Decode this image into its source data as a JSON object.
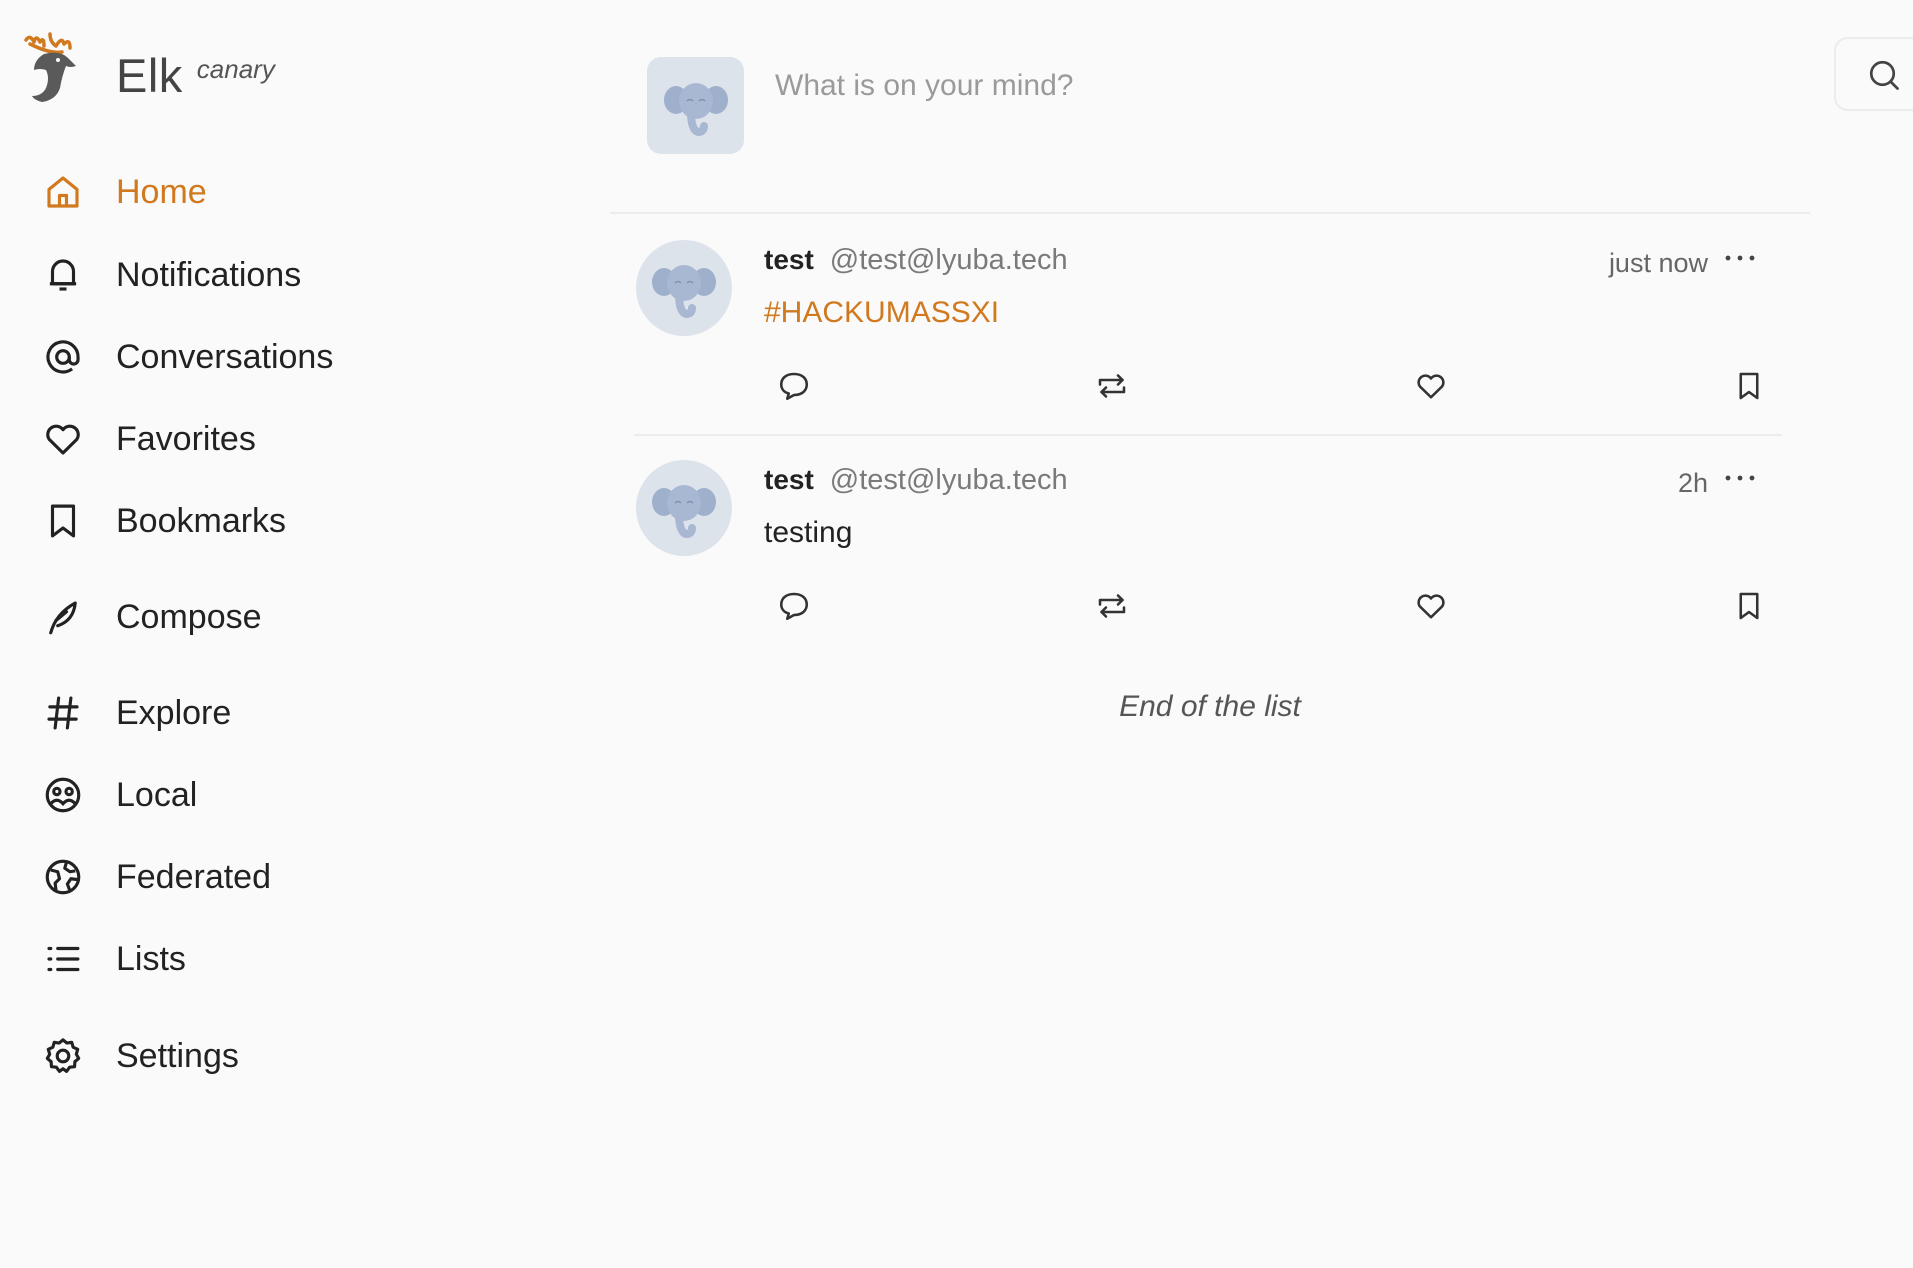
{
  "app": {
    "title": "Elk",
    "tag": "canary",
    "accent_color": "#d0791f"
  },
  "sidebar": {
    "items": [
      {
        "label": "Home",
        "icon": "home-icon",
        "active": true
      },
      {
        "label": "Notifications",
        "icon": "bell-icon"
      },
      {
        "label": "Conversations",
        "icon": "at-sign-icon"
      },
      {
        "label": "Favorites",
        "icon": "heart-icon"
      },
      {
        "label": "Bookmarks",
        "icon": "bookmark-icon"
      },
      {
        "label": "Compose",
        "icon": "feather-icon"
      },
      {
        "label": "Explore",
        "icon": "hashtag-icon"
      },
      {
        "label": "Local",
        "icon": "group-icon"
      },
      {
        "label": "Federated",
        "icon": "globe-icon"
      },
      {
        "label": "Lists",
        "icon": "list-icon"
      },
      {
        "label": "Settings",
        "icon": "gear-icon"
      }
    ]
  },
  "composer": {
    "placeholder": "What is on your mind?"
  },
  "timeline": {
    "statuses": [
      {
        "display_name": "test",
        "handle": "@test@lyuba.tech",
        "time": "just now",
        "content": "#HACKUMASSXI",
        "is_hashtag": true
      },
      {
        "display_name": "test",
        "handle": "@test@lyuba.tech",
        "time": "2h",
        "content": "testing",
        "is_hashtag": false
      }
    ],
    "end_text": "End of the list"
  }
}
